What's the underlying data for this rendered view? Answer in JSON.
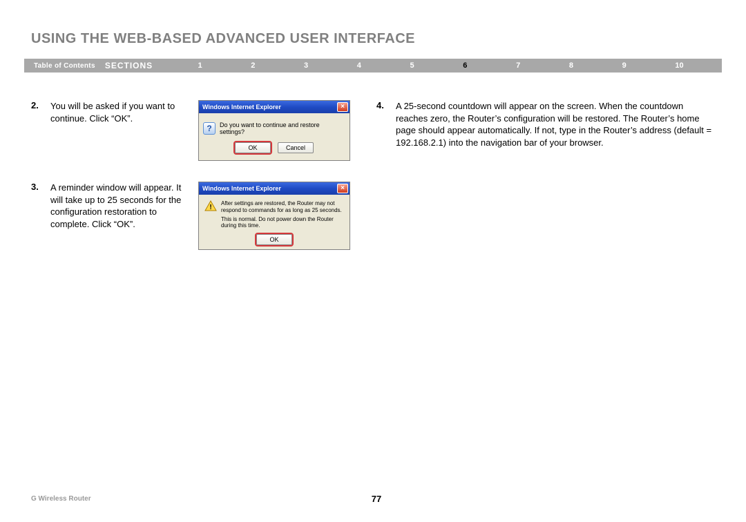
{
  "title": "USING THE WEB-BASED ADVANCED USER INTERFACE",
  "nav": {
    "toc": "Table of Contents",
    "sections": "SECTIONS",
    "items": [
      "1",
      "2",
      "3",
      "4",
      "5",
      "6",
      "7",
      "8",
      "9",
      "10"
    ],
    "active_index": 5
  },
  "steps": {
    "s2": {
      "num": "2.",
      "text": "You will be asked if you want to continue. Click “OK”."
    },
    "s3": {
      "num": "3.",
      "text": "A reminder window will appear. It will take up to 25 seconds for the configuration restoration to complete. Click “OK”."
    },
    "s4": {
      "num": "4.",
      "text": "A 25-second countdown will appear on the screen. When the countdown reaches zero, the Router’s configuration will be restored. The Router’s home page should appear automatically. If not, type in the Router’s address (default = 192.168.2.1) into the navigation bar of your browser."
    }
  },
  "dlg1": {
    "title": "Windows Internet Explorer",
    "msg": "Do you want to continue and restore settings?",
    "ok": "OK",
    "cancel": "Cancel"
  },
  "dlg2": {
    "title": "Windows Internet Explorer",
    "line1": "After settings are restored, the Router may not respond to commands for as long as 25 seconds.",
    "line2": "This is normal. Do not power down the Router during this time.",
    "ok": "OK"
  },
  "footer": {
    "product": "G Wireless Router",
    "page": "77"
  }
}
